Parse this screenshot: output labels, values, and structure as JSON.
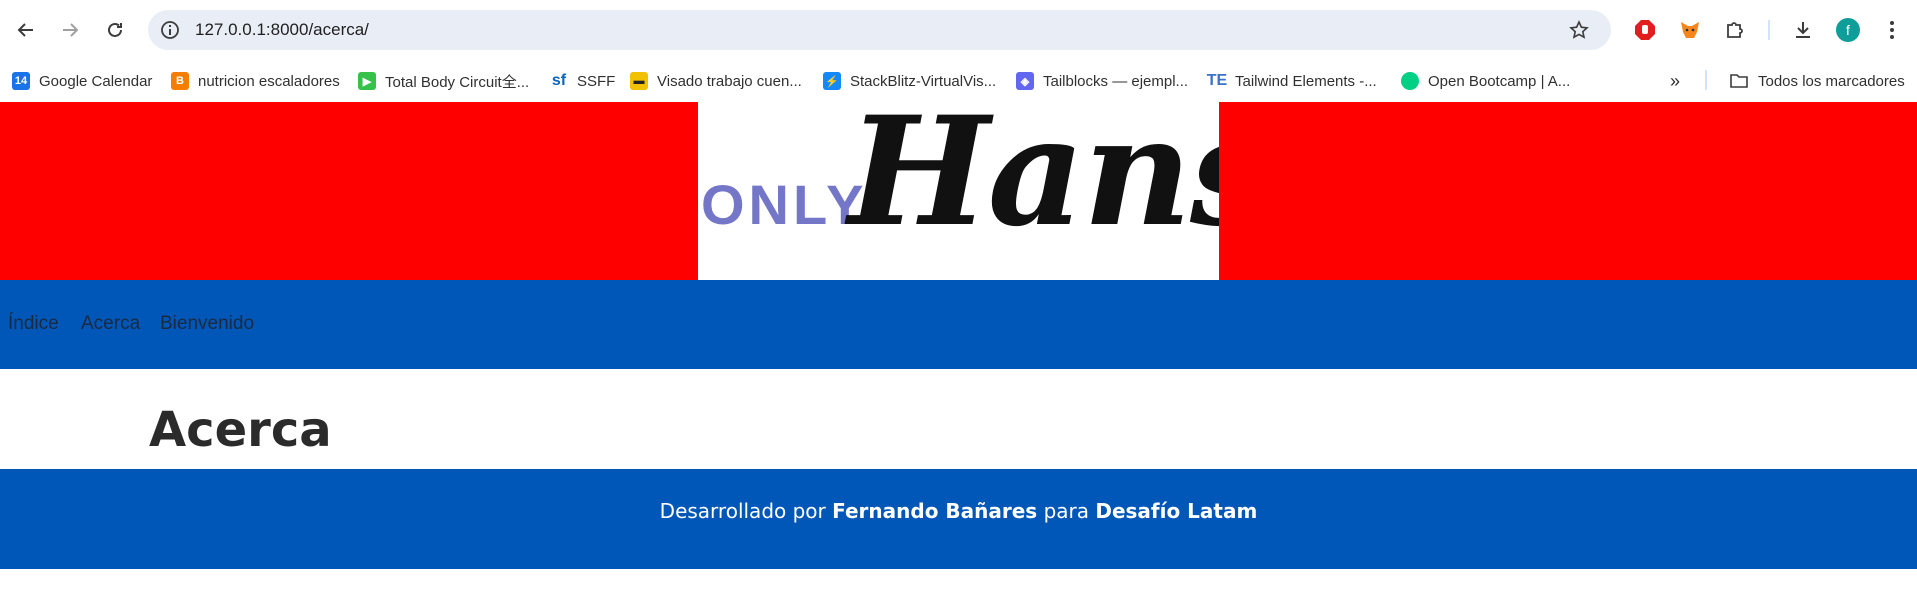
{
  "browser": {
    "url": "127.0.0.1:8000/acerca/",
    "profile_initial": "f"
  },
  "bookmarks": [
    {
      "label": "Google Calendar",
      "icon": "calendar-icon",
      "color": "#1a73e8"
    },
    {
      "label": "nutricion escaladores",
      "icon": "blogger-icon",
      "color": "#f57d00"
    },
    {
      "label": "Total Body Circuit全...",
      "icon": "video-icon",
      "color": "#35c14a"
    },
    {
      "label": "SSFF",
      "icon": "sf-icon",
      "color": "#0a66c2"
    },
    {
      "label": "Visado trabajo cuen...",
      "icon": "card-icon",
      "color": "#f2c200"
    },
    {
      "label": "StackBlitz-VirtualVis...",
      "icon": "bolt-icon",
      "color": "#1389fd"
    },
    {
      "label": "Tailblocks — ejempl...",
      "icon": "layers-icon",
      "color": "#6366f1"
    },
    {
      "label": "Tailwind Elements -...",
      "icon": "te-icon",
      "color": "#3b71ca"
    },
    {
      "label": "Open Bootcamp | A...",
      "icon": "ob-icon",
      "color": "#00d084"
    }
  ],
  "bookmarks_all": "Todos los marcadores",
  "hero": {
    "logo_prefix": "ONLY",
    "logo_script": "Hans"
  },
  "nav": [
    "Índice",
    "Acerca",
    "Bienvenido"
  ],
  "page": {
    "title": "Acerca"
  },
  "footer": {
    "prefix": "Desarrollado por",
    "author": "Fernando Bañares",
    "middle": "para",
    "org": "Desafío Latam"
  },
  "colors": {
    "hero_bg": "#ff0000",
    "nav_bg": "#0057b8",
    "footer_bg": "#0057b8",
    "logo_prefix": "#7476c8"
  }
}
